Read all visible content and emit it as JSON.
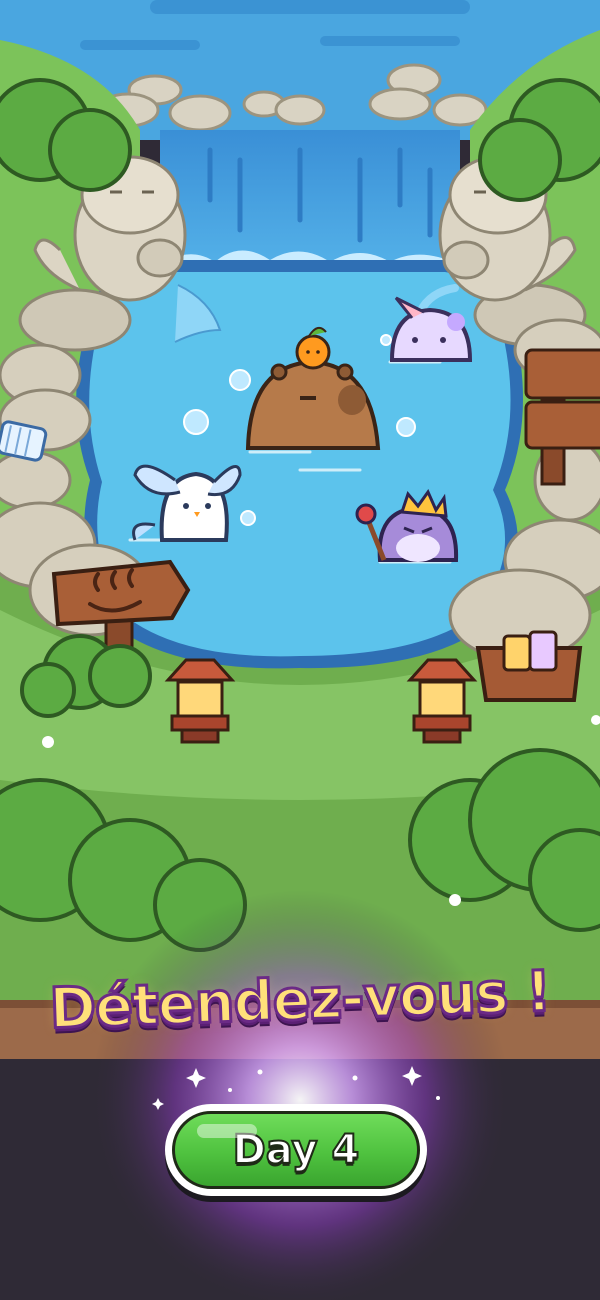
{
  "banner": {
    "title": "Détendez-vous !"
  },
  "button": {
    "label": "Day 4"
  },
  "colors": {
    "water": "#5cc3ec",
    "grass": "#6fb44f",
    "title_fill": "#ffe07a",
    "title_outline": "#6b2a86",
    "button_green": "#4fc23f",
    "background_bottom": "#2f2a36"
  },
  "icons": [
    "hot-spring-sign-icon",
    "wooden-signpost-icon",
    "stone-lantern-icon",
    "towel-icon",
    "sparkle-icon",
    "potion-basket-icon"
  ]
}
